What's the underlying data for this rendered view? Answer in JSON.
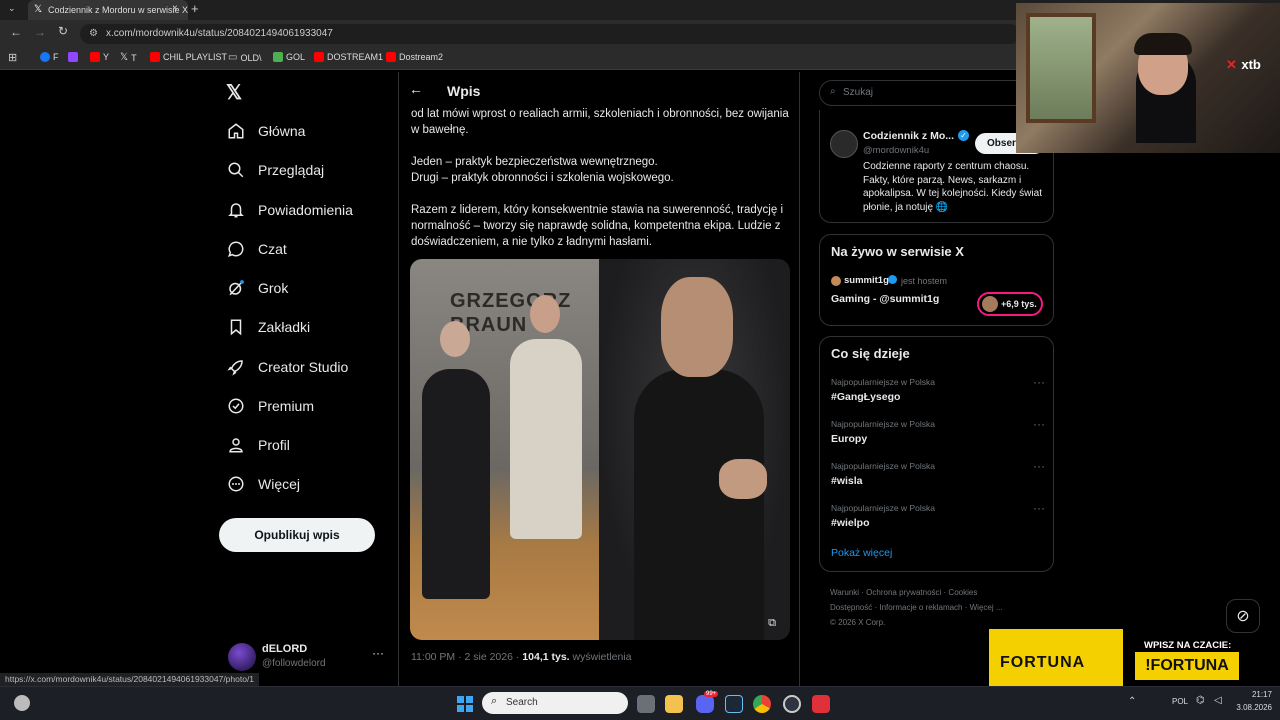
{
  "browser": {
    "tab_title": "Codziennik z Mordoru w serwisie X",
    "url": "x.com/mordownik4u/status/2084021494061933047",
    "bookmarks": [
      "F",
      "Y",
      "T",
      "CHIL PLAYLIST",
      "OLD\\",
      "GOL",
      "DOSTREAM1",
      "Dostream2"
    ],
    "status_url": "https://x.com/mordownik4u/status/2084021494061933047/photo/1"
  },
  "nav": {
    "items": [
      "Główna",
      "Przeglądaj",
      "Powiadomienia",
      "Czat",
      "Grok",
      "Zakładki",
      "Creator Studio",
      "Premium",
      "Profil",
      "Więcej"
    ],
    "post_button": "Opublikuj wpis",
    "account_name": "dELORD",
    "account_handle": "@followdelord"
  },
  "post": {
    "header_title": "Wpis",
    "paragraph1": "od lat mówi wprost o realiach armii, szkoleniach i obronności, bez owijania w bawełnę.",
    "line_a": "Jeden – praktyk bezpieczeństwa wewnętrznego.",
    "line_b": "Drugi – praktyk obronności i szkolenia wojskowego.",
    "paragraph3": "Razem z liderem, który konsekwentnie stawia na suwerenność, tradycję i normalność – tworzy się naprawdę solidna, kompetentna ekipa. Ludzie z doświadczeniem, a nie tylko z ładnymi hasłami.",
    "banner_text": "GRZEGORZ BRAUN",
    "time": "11:00 PM · 2 sie 2026 ·",
    "views": "104,1 tys.",
    "views_label": "wyświetlenia"
  },
  "right": {
    "search_placeholder": "Szukaj",
    "profile": {
      "name": "Codziennik z Mo...",
      "handle": "@mordownik4u",
      "follow": "Obserw",
      "bio": "Codzienne raporty z centrum chaosu. Fakty, które parzą. News, sarkazm i apokalipsa. W tej kolejności. Kiedy świat płonie, ja notuję 🌐"
    },
    "live": {
      "title": "Na żywo w serwisie X",
      "host": "summit1g",
      "host_label": "jest hostem",
      "stream": "Gaming - @summit1g",
      "count": "+6,9 tys."
    },
    "trends": {
      "title": "Co się dzieje",
      "items": [
        {
          "category": "Najpopularniejsze w Polska",
          "name": "#GangŁysego"
        },
        {
          "category": "Najpopularniejsze w Polska",
          "name": "Europy"
        },
        {
          "category": "Najpopularniejsze w Polska",
          "name": "#wisla"
        },
        {
          "category": "Najpopularniejsze w Polska",
          "name": "#wielpo"
        }
      ],
      "more": "Pokaż więcej"
    },
    "footer": {
      "links": [
        "Warunki",
        "Ochrona prywatności",
        "Cookies",
        "Dostępność",
        "Informacje o reklamach",
        "Więcej ..."
      ],
      "copyright": "© 2026 X Corp."
    }
  },
  "overlay": {
    "xtb": "xtb",
    "fortuna": "FORTUNA",
    "fortuna_cta": "WPISZ NA CZACIE:",
    "fortuna_code": "!FORTUNA"
  },
  "taskbar": {
    "search": "Search",
    "lang": "POL",
    "time": "21:17",
    "date": "3.08.2026",
    "badge": "99+"
  },
  "colors": {
    "accent": "#1d9bf0",
    "fortuna_yellow": "#f5d000",
    "live_border": "#f91880"
  }
}
